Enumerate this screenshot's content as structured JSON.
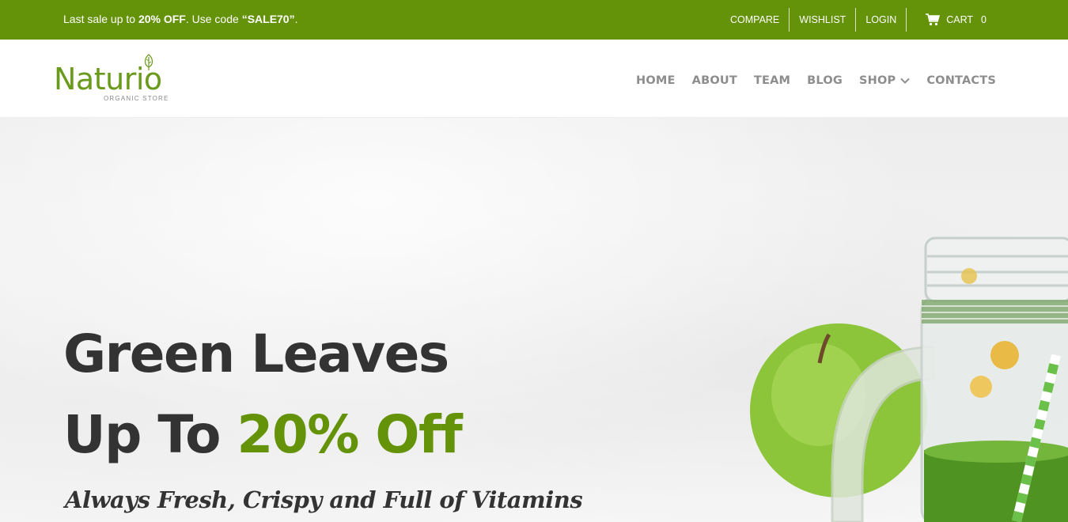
{
  "topbar": {
    "promo_prefix": "Last sale up to ",
    "promo_bold1": "20% OFF",
    "promo_middle": ". Use code ",
    "promo_bold2": "“SALE70”",
    "promo_suffix": ".",
    "links": {
      "compare": "COMPARE",
      "wishlist": "WISHLIST",
      "login": "LOGIN",
      "cart": "CART",
      "cart_count": "0"
    }
  },
  "header": {
    "logo_word": "Naturio",
    "logo_sub": "ORGANIC STORE",
    "nav": {
      "home": "HOME",
      "about": "ABOUT",
      "team": "TEAM",
      "blog": "BLOG",
      "shop": "SHOP",
      "contacts": "CONTACTS"
    }
  },
  "hero": {
    "line1": "Green Leaves",
    "line2_prefix": "Up To ",
    "line2_accent": "20% Off",
    "tagline": "Always Fresh, Crispy and Full of Vitamins"
  },
  "colors": {
    "brand_green": "#649309",
    "heading": "#333333",
    "nav_text": "#8d8d8d"
  },
  "icons": {
    "cart": "cart-icon",
    "shop_dropdown": "chevron-down-icon",
    "logo": "leaf-icon"
  }
}
